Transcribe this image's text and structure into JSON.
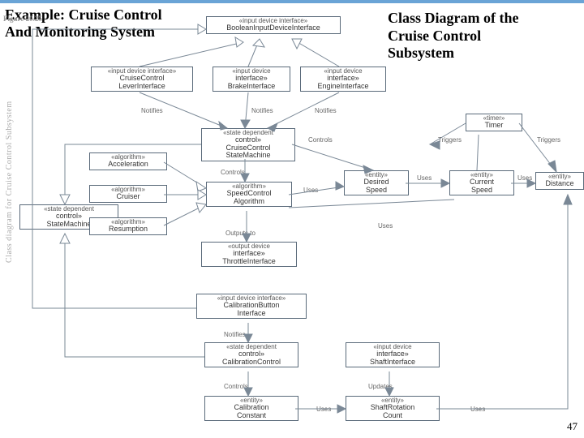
{
  "page": "47",
  "titles": {
    "example_l1": "Example: Cruise Control",
    "example_l2": "And Monitoring System",
    "cd_l1": "Class Diagram of the",
    "cd_l2": "Cruise Control",
    "cd_l3": "Subsystem"
  },
  "fig": {
    "num": "Figure 20.25",
    "caption": "Class diagram for Cruise Control Subsystem"
  },
  "labels": {
    "notifies": "Notifies",
    "controls": "Controls",
    "uses": "Uses",
    "outputs": "Outputs to",
    "triggers": "Triggers",
    "updates": "Updates"
  },
  "nodes": {
    "booleanInput": {
      "st": "«input device interface»",
      "name": "BooleanInputDeviceInterface"
    },
    "lever": {
      "st": "«input device interface»",
      "n1": "CruiseControl",
      "n2": "LeverInterface"
    },
    "brake": {
      "st": "«input device",
      "n2": "interface»",
      "name": "BrakeInterface"
    },
    "engine": {
      "st": "«input device",
      "n2": "interface»",
      "name": "EngineInterface"
    },
    "ccsm": {
      "st": "«state dependent",
      "n2": "control»",
      "n1": "CruiseControl",
      "name": "StateMachine"
    },
    "accel": {
      "st": "«algorithm»",
      "name": "Acceleration"
    },
    "cruiser": {
      "st": "«algorithm»",
      "name": "Cruiser"
    },
    "resump": {
      "st": "«algorithm»",
      "name": "Resumption"
    },
    "sm": {
      "st": "«state dependent",
      "n2": "control»",
      "name": "StateMachine"
    },
    "sca": {
      "st": "«algorithm»",
      "n1": "SpeedControl",
      "name": "Algorithm"
    },
    "throttle": {
      "st": "«output device",
      "n2": "interface»",
      "name": "ThrottleInterface"
    },
    "desired": {
      "st": "«entity»",
      "n1": "Desired",
      "name": "Speed"
    },
    "current": {
      "st": "«entity»",
      "n1": "Current",
      "name": "Speed"
    },
    "distance": {
      "st": "«entity»",
      "name": "Distance"
    },
    "timer": {
      "st": "«timer»",
      "name": "Timer"
    },
    "calibBtn": {
      "st": "«input device interface»",
      "n1": "CalibrationButton",
      "name": "Interface"
    },
    "calibCtrl": {
      "st": "«state dependent",
      "n2": "control»",
      "name": "CalibrationControl"
    },
    "calibConst": {
      "st": "«entity»",
      "n1": "Calibration",
      "name": "Constant"
    },
    "shaftIf": {
      "st": "«input device",
      "n2": "interface»",
      "name": "ShaftInterface"
    },
    "shaftRot": {
      "st": "«entity»",
      "n1": "ShaftRotation",
      "name": "Count"
    }
  }
}
